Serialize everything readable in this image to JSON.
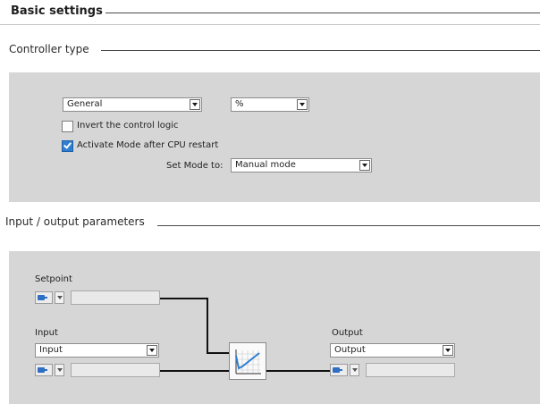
{
  "basic_settings": {
    "title": "Basic settings"
  },
  "controller_type": {
    "title": "Controller type",
    "type_select": {
      "value": "General"
    },
    "unit_select": {
      "value": "%"
    },
    "invert_logic": {
      "label": "Invert the control logic",
      "checked": false
    },
    "activate_mode": {
      "label": "Activate Mode after CPU restart",
      "checked": true
    },
    "set_mode": {
      "label": "Set Mode to:",
      "value": "Manual mode"
    }
  },
  "io_parameters": {
    "title": "Input / output parameters",
    "setpoint": {
      "label": "Setpoint",
      "value": ""
    },
    "input": {
      "label": "Input",
      "select_value": "Input",
      "value": ""
    },
    "output": {
      "label": "Output",
      "select_value": "Output",
      "value": ""
    },
    "icons": {
      "pointer": "plug-icon",
      "block": "pid-controller-icon"
    }
  },
  "colors": {
    "accent": "#2f7fd0",
    "panel": "#d6d6d6",
    "line": "#111111"
  }
}
